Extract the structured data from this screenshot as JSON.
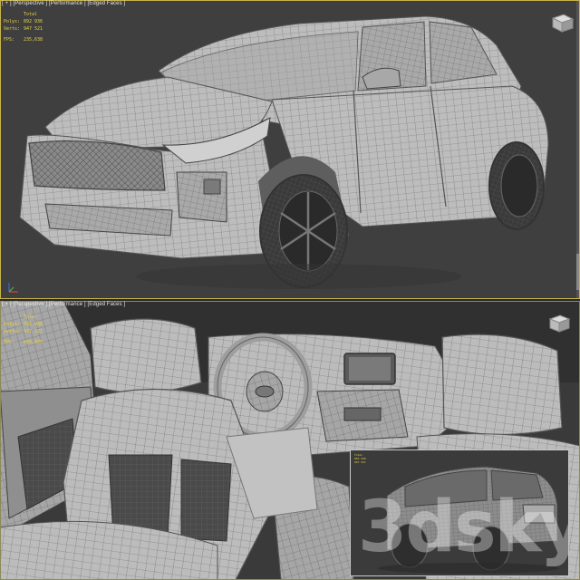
{
  "top_viewport": {
    "label": "[ + ] [Perspective ] [Performance ] [Edged Faces ]",
    "stats": {
      "total_label": "Total",
      "polys_label": "Polys:",
      "polys_value": "892 936",
      "verts_label": "Verts:",
      "verts_value": "947 521",
      "fps_label": "FPS:",
      "fps_value": "235,638"
    }
  },
  "bottom_viewport": {
    "label": "[ + ] [Perspective ] [Performance ] [Edged Faces ]",
    "stats": {
      "total_label": "Total",
      "polys_label": "Polys:",
      "polys_value": "892 936",
      "verts_label": "Verts:",
      "verts_value": "947 521",
      "fps_label": "FPS:",
      "fps_value": "465,875"
    }
  },
  "inset_viewport": {
    "watermark": "3dsky"
  },
  "colors": {
    "active_border": "#c9b44a",
    "stats_text": "#e8d24a",
    "mesh_fill": "#b9b9b9",
    "wire": "#6e6e6e",
    "viewport_bg": "#3f3f3f"
  },
  "icons": {
    "axis_gizmo": "axis-tripod-icon",
    "viewcube": "viewcube-icon"
  }
}
